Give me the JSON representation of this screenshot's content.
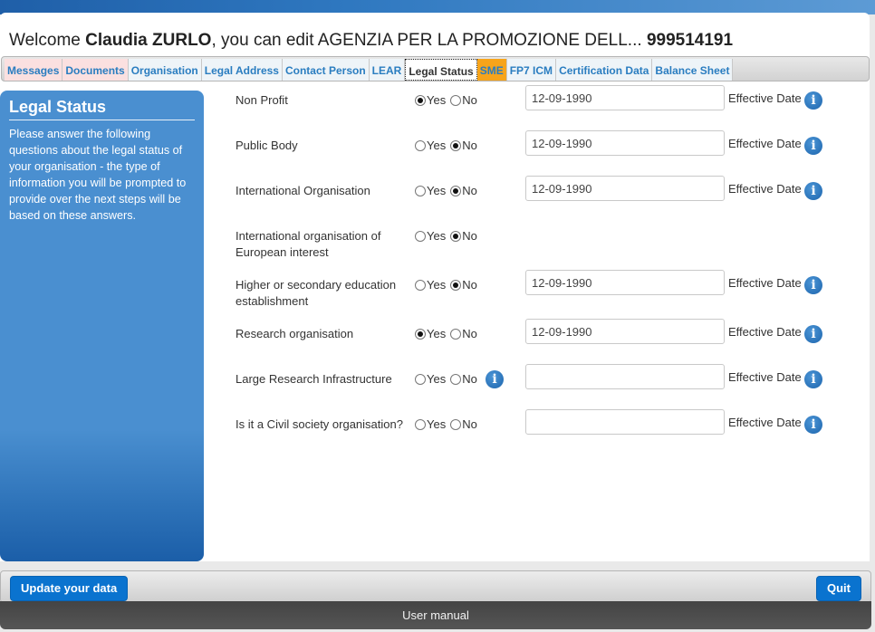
{
  "header": {
    "welcome_prefix": "Welcome ",
    "user_name": "Claudia ZURLO",
    "welcome_middle": ", you can edit AGENZIA PER LA PROMOZIONE DELL... ",
    "pic_number": "999514191"
  },
  "tabs": [
    {
      "label": "Messages",
      "state": "highlighted"
    },
    {
      "label": "Documents",
      "state": "highlighted"
    },
    {
      "label": "Organisation",
      "state": "normal"
    },
    {
      "label": "Legal Address",
      "state": "normal"
    },
    {
      "label": "Contact Person",
      "state": "normal"
    },
    {
      "label": "LEAR",
      "state": "normal"
    },
    {
      "label": "Legal Status",
      "state": "active"
    },
    {
      "label": "SME",
      "state": "warning"
    },
    {
      "label": "FP7 ICM",
      "state": "normal"
    },
    {
      "label": "Certification Data",
      "state": "normal"
    },
    {
      "label": "Balance Sheet",
      "state": "normal"
    }
  ],
  "sidebar": {
    "title": "Legal Status",
    "description": "Please answer the following questions about the legal status of your organisation - the type of information you will be prompted to provide over the next steps will be based on these answers."
  },
  "radio_labels": {
    "yes": "Yes",
    "no": "No"
  },
  "effective_date_label": "Effective Date",
  "questions": [
    {
      "label": "Non Profit",
      "value": "Yes",
      "date": "12-09-1990",
      "has_date": true
    },
    {
      "label": "Public Body",
      "value": "No",
      "date": "12-09-1990",
      "has_date": true
    },
    {
      "label": "International Organisation",
      "value": "No",
      "date": "12-09-1990",
      "has_date": true
    },
    {
      "label": "International organisation of European interest",
      "value": "No",
      "date": "",
      "has_date": false
    },
    {
      "label": "Higher or secondary education establishment",
      "value": "No",
      "date": "12-09-1990",
      "has_date": true
    },
    {
      "label": "Research organisation",
      "value": "Yes",
      "date": "12-09-1990",
      "has_date": true
    },
    {
      "label": "Large Research Infrastructure",
      "value": "",
      "date": "",
      "has_date": true,
      "inline_info": true
    },
    {
      "label": "Is it a Civil society organisation?",
      "value": "",
      "date": "",
      "has_date": true
    }
  ],
  "actions": {
    "update_label": "Update your data",
    "quit_label": "Quit"
  },
  "footer": {
    "user_manual_label": "User manual"
  },
  "icons": {
    "info": "i"
  },
  "colors": {
    "accent": "#0a73cf",
    "sidebar": "#4a8fd0",
    "tab_text": "#2a7dc0",
    "tab_sme": "#f7a41a",
    "tab_highlight": "#fbe0e0"
  }
}
